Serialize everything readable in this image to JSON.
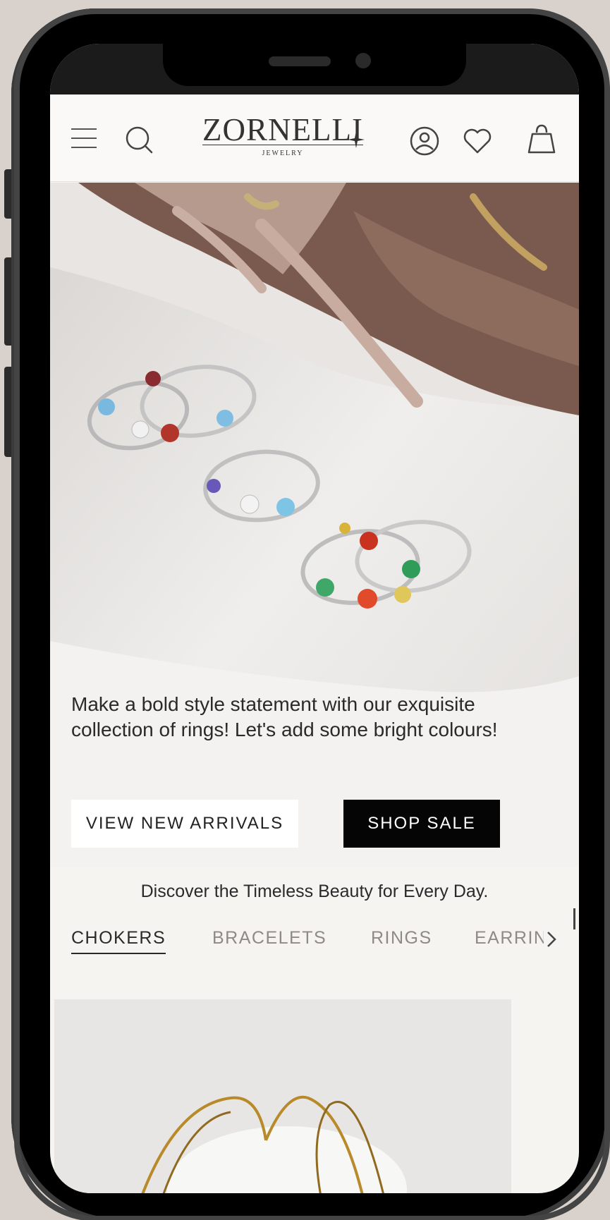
{
  "header": {
    "logo_text": "ZORNELLI",
    "logo_subtext": "JEWELRY",
    "icons": [
      "menu-icon",
      "search-icon",
      "account-icon",
      "heart-icon",
      "bag-icon"
    ]
  },
  "hero": {
    "copy": "Make a bold style statement with our exquisite collection of rings! Let's add some bright colours!",
    "primary_button": "VIEW NEW ARRIVALS",
    "secondary_button": "SHOP SALE"
  },
  "discover": {
    "heading": "Discover the Timeless Beauty for Every Day.",
    "tabs": [
      {
        "label": "CHOKERS",
        "active": true
      },
      {
        "label": "BRACELETS",
        "active": false
      },
      {
        "label": "RINGS",
        "active": false
      },
      {
        "label": "EARRINGS",
        "active": false
      }
    ]
  },
  "colors": {
    "background": "#d9d2cc",
    "primary_button_bg": "#ffffff",
    "secondary_button_bg": "#050505",
    "text": "#2a2a2a"
  }
}
